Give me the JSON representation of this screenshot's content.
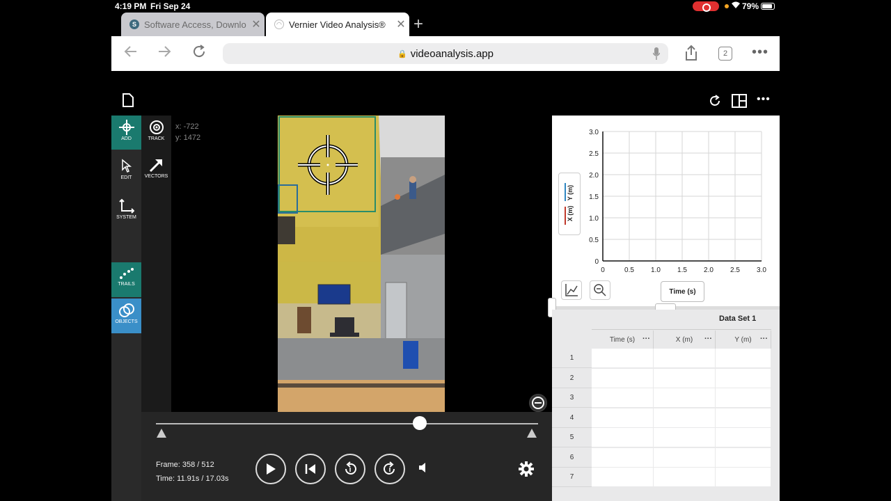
{
  "status": {
    "time": "4:19 PM",
    "date": "Fri Sep 24",
    "battery": "79%"
  },
  "browser": {
    "tabs": [
      {
        "title": "Software Access, Downlo",
        "favicon": "S",
        "active": false
      },
      {
        "title": "Vernier Video Analysis®",
        "favicon": "",
        "active": true
      }
    ],
    "url": "videoanalysis.app",
    "tab_count": "2"
  },
  "tools": {
    "add": "ADD",
    "track": "TRACK",
    "edit": "EDIT",
    "vectors": "VECTORS",
    "system": "SYSTEM",
    "trails": "TRAILS",
    "objects": "OBJECTS"
  },
  "coords": {
    "x": "x: -722",
    "y": "y: 1472"
  },
  "playback": {
    "frame": "Frame: 358 / 512",
    "time": "Time: 11.91s / 17.03s",
    "position_fraction": 0.69
  },
  "graph": {
    "y_legend": "X (m)   Y (m)",
    "x_button": "Time (s)",
    "colors": {
      "x_series": "#c0392b",
      "y_series": "#2e86c1"
    }
  },
  "chart_data": {
    "type": "line",
    "xlabel": "Time (s)",
    "ylabel": "X (m)  Y (m)",
    "xlim": [
      0,
      3.0
    ],
    "ylim": [
      0,
      3.0
    ],
    "x_ticks": [
      "0",
      "0.5",
      "1.0",
      "1.5",
      "2.0",
      "2.5",
      "3.0"
    ],
    "y_ticks": [
      "0",
      "0.5",
      "1.0",
      "1.5",
      "2.0",
      "2.5",
      "3.0"
    ],
    "grid": true,
    "series": [
      {
        "name": "X (m)",
        "values": []
      },
      {
        "name": "Y (m)",
        "values": []
      }
    ]
  },
  "table": {
    "dataset": "Data Set 1",
    "columns": [
      "Time (s)",
      "X (m)",
      "Y (m)"
    ],
    "rows": [
      "1",
      "2",
      "3",
      "4",
      "5",
      "6",
      "7"
    ]
  }
}
